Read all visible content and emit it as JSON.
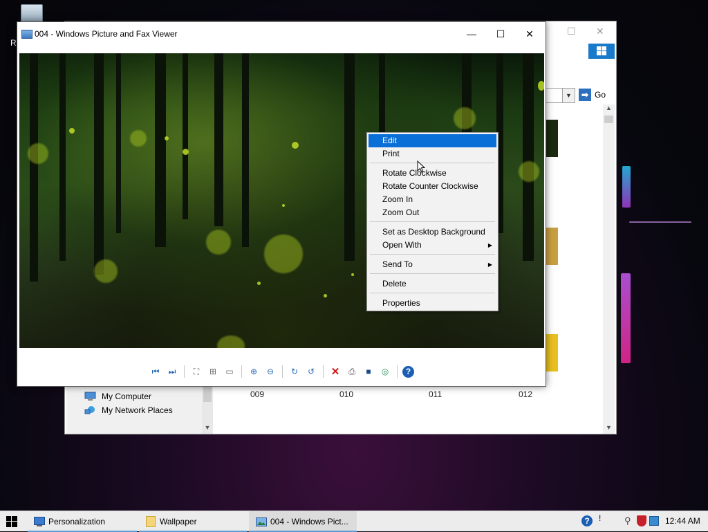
{
  "desktop": {
    "recycle_bin_label": "R"
  },
  "explorer": {
    "go_label": "Go",
    "places": [
      {
        "label": "My Computer",
        "icon": "my-computer-icon"
      },
      {
        "label": "My Network Places",
        "icon": "network-places-icon"
      }
    ],
    "thumbnails": [
      "009",
      "010",
      "011",
      "012"
    ]
  },
  "viewer": {
    "title": "004 - Windows Picture and Fax Viewer",
    "toolbar": [
      "previous-image-icon",
      "next-image-icon",
      "best-fit-icon",
      "actual-size-icon",
      "slideshow-icon",
      "zoom-in-icon",
      "zoom-out-icon",
      "rotate-clockwise-icon",
      "rotate-counterclockwise-icon",
      "delete-icon",
      "print-icon",
      "save-icon",
      "open-with-icon",
      "help-icon"
    ]
  },
  "context_menu": {
    "items": [
      {
        "label": "Edit",
        "highlighted": true
      },
      {
        "label": "Print"
      },
      {
        "label": "Rotate Clockwise"
      },
      {
        "label": "Rotate Counter Clockwise"
      },
      {
        "label": "Zoom In"
      },
      {
        "label": "Zoom Out"
      },
      {
        "label": "Set as Desktop Background"
      },
      {
        "label": "Open With",
        "submenu": true
      },
      {
        "label": "Send To",
        "submenu": true
      },
      {
        "label": "Delete"
      },
      {
        "label": "Properties"
      }
    ],
    "highlight_color": "#0a6fd6"
  },
  "taskbar": {
    "items": [
      {
        "label": "Personalization",
        "icon": "personalization-icon"
      },
      {
        "label": "Wallpaper",
        "icon": "folder-icon"
      },
      {
        "label": "004 - Windows Pict...",
        "icon": "picture-viewer-icon",
        "active": true
      }
    ],
    "clock": "12:44 AM"
  }
}
